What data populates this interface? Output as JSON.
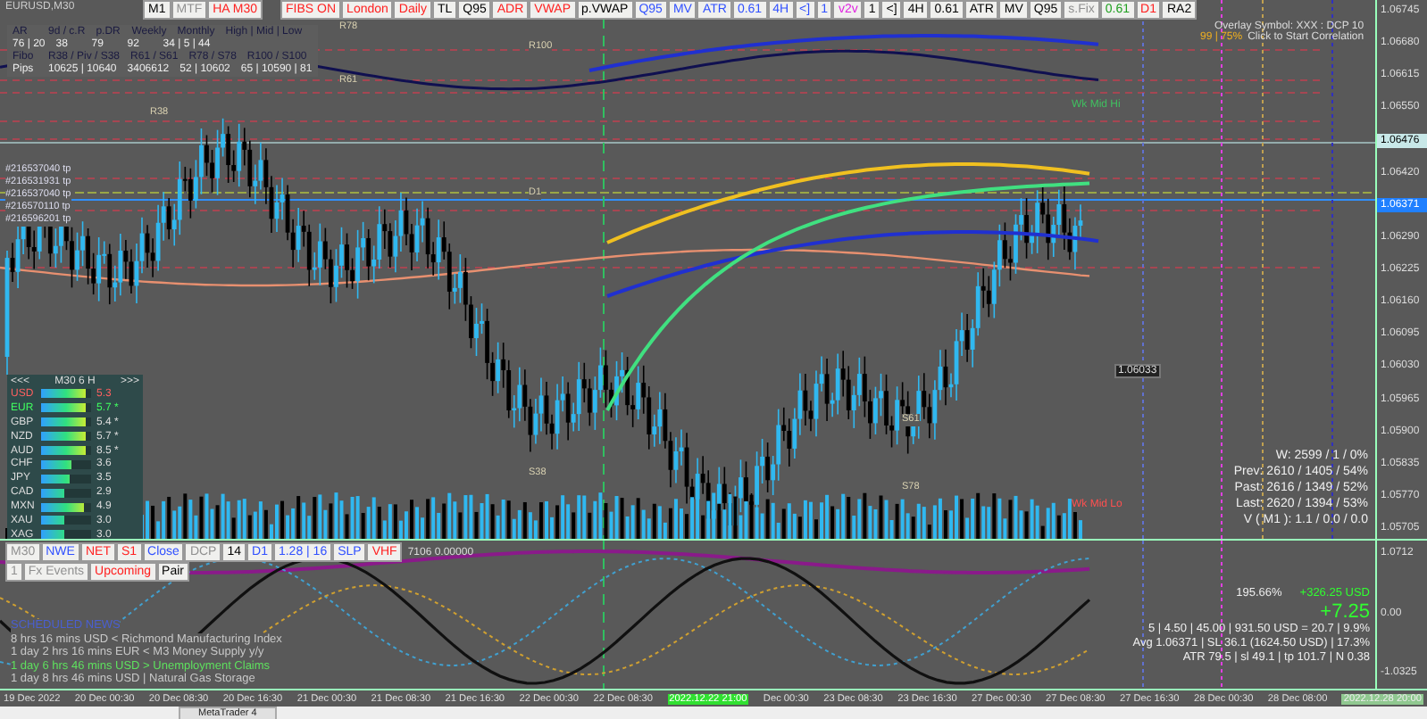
{
  "symbol": "EURUSD,M30",
  "toolbar_left": [
    {
      "label": "M1",
      "color": "#000000"
    },
    {
      "label": "MTF",
      "color": "#909090"
    },
    {
      "label": "HA M30",
      "color": "#ff2020"
    }
  ],
  "toolbar_right": [
    {
      "label": "FIBS ON",
      "color": "#ff2020"
    },
    {
      "label": "London",
      "color": "#ff2020"
    },
    {
      "label": "Daily",
      "color": "#ff2020"
    },
    {
      "label": "TL",
      "color": "#000000"
    },
    {
      "label": "Q95",
      "color": "#000000"
    },
    {
      "label": "ADR",
      "color": "#ff2020"
    },
    {
      "label": "VWAP",
      "color": "#ff2020"
    },
    {
      "label": "p.VWAP",
      "color": "#000000"
    },
    {
      "label": "Q95",
      "color": "#3050ff"
    },
    {
      "label": "MV",
      "color": "#3050ff"
    },
    {
      "label": "ATR",
      "color": "#3050ff"
    },
    {
      "label": "0.61",
      "color": "#3050ff"
    },
    {
      "label": "4H",
      "color": "#3050ff"
    },
    {
      "label": "<]",
      "color": "#3050ff"
    },
    {
      "label": "1",
      "color": "#3050ff"
    },
    {
      "label": "v2v",
      "color": "#e020e0"
    },
    {
      "label": "1",
      "color": "#000000"
    },
    {
      "label": "<]",
      "color": "#000000"
    },
    {
      "label": "4H",
      "color": "#000000"
    },
    {
      "label": "0.61",
      "color": "#000000"
    },
    {
      "label": "ATR",
      "color": "#000000"
    },
    {
      "label": "MV",
      "color": "#000000"
    },
    {
      "label": "Q95",
      "color": "#000000"
    },
    {
      "label": "s.Fix",
      "color": "#909090"
    },
    {
      "label": "0.61",
      "color": "#20a020"
    },
    {
      "label": "D1",
      "color": "#ff2020"
    },
    {
      "label": "RA2",
      "color": "#000000"
    }
  ],
  "range_table": {
    "header": [
      "AR",
      "9d / c.R",
      "p.DR",
      "Weekly",
      "Monthly",
      "High | Mid | Low"
    ],
    "values": [
      "76 | 20",
      "38",
      "79",
      "92",
      "34 | 5 | 44"
    ]
  },
  "fibo_table": {
    "header": [
      "Fibo",
      "R38 / Piv / S38",
      "R61 / S61",
      "R78 / S78",
      "R100 / S100"
    ],
    "values": [
      "Pips",
      "10625 | 10640",
      "3406612",
      "52 | 10602",
      "65 | 10590 | 81"
    ]
  },
  "orders": [
    "#216537040 tp",
    "#216531931 tp",
    "#216537040 tp",
    "#216570110 tp",
    "#216596201 tp"
  ],
  "levels": [
    "R78",
    "R61",
    "R38",
    "R100",
    "D1",
    "S38",
    "S61",
    "S78"
  ],
  "overlay": {
    "symbol_text": "Overlay Symbol: XXX : DCP 10",
    "count": "99 | 75%",
    "action": "Click to Start Correlation"
  },
  "weekly_mid": {
    "high": "Wk Mid Hi",
    "low": "Wk Mid Lo"
  },
  "volume_stats": [
    "W: 2599 / 1 / 0%",
    "Prev: 2610 / 1405 / 54%",
    "Past: 2616 / 1349 / 52%",
    "Last: 2620 / 1394 / 53%",
    "V ( M1 ): 1.1 / 0.0 / 0.0"
  ],
  "price_tag": "1.06033",
  "strength": {
    "prev": "<<<",
    "period": "M30 6 H",
    "next": ">>>",
    "rows": [
      {
        "name": "USD",
        "color": "#ff6060",
        "level": 0.9,
        "value": "5.3"
      },
      {
        "name": "EUR",
        "color": "#40ff60",
        "level": 0.9,
        "value": "5.7 *"
      },
      {
        "name": "GBP",
        "color": "#dddddd",
        "level": 0.9,
        "value": "5.4 *"
      },
      {
        "name": "NZD",
        "color": "#dddddd",
        "level": 0.88,
        "value": "5.7 *"
      },
      {
        "name": "AUD",
        "color": "#dddddd",
        "level": 0.88,
        "value": "8.5 *"
      },
      {
        "name": "CHF",
        "color": "#dddddd",
        "level": 0.6,
        "value": "3.6"
      },
      {
        "name": "JPY",
        "color": "#dddddd",
        "level": 0.58,
        "value": "3.5"
      },
      {
        "name": "CAD",
        "color": "#dddddd",
        "level": 0.45,
        "value": "2.9"
      },
      {
        "name": "MXN",
        "color": "#dddddd",
        "level": 0.85,
        "value": "4.9"
      },
      {
        "name": "XAU",
        "color": "#dddddd",
        "level": 0.45,
        "value": "3.0"
      },
      {
        "name": "XAG",
        "color": "#dddddd",
        "level": 0.45,
        "value": "3.0"
      }
    ]
  },
  "price_axis": [
    {
      "label": "1.06745",
      "kind": "tick"
    },
    {
      "label": "1.06680",
      "kind": "tick"
    },
    {
      "label": "1.06615",
      "kind": "tick"
    },
    {
      "label": "1.06550",
      "kind": "tick"
    },
    {
      "label": "1.06476",
      "kind": "bid"
    },
    {
      "label": "1.06420",
      "kind": "tick"
    },
    {
      "label": "1.06371",
      "kind": "avg"
    },
    {
      "label": "1.06290",
      "kind": "tick"
    },
    {
      "label": "1.06225",
      "kind": "tick"
    },
    {
      "label": "1.06160",
      "kind": "tick"
    },
    {
      "label": "1.06095",
      "kind": "tick"
    },
    {
      "label": "1.06030",
      "kind": "tick"
    },
    {
      "label": "1.05965",
      "kind": "tick"
    },
    {
      "label": "1.05900",
      "kind": "tick"
    },
    {
      "label": "1.05835",
      "kind": "tick"
    },
    {
      "label": "1.05770",
      "kind": "tick"
    },
    {
      "label": "1.05705",
      "kind": "tick"
    }
  ],
  "indicator_buttons_row1": [
    {
      "label": "M30",
      "color": "#909090"
    },
    {
      "label": "NWE",
      "color": "#3050ff"
    },
    {
      "label": "NET",
      "color": "#ff2020"
    },
    {
      "label": "S1",
      "color": "#ff2020"
    },
    {
      "label": "Close",
      "color": "#3050ff"
    },
    {
      "label": "DCP",
      "color": "#909090"
    },
    {
      "label": "14",
      "color": "#000000"
    },
    {
      "label": "D1",
      "color": "#3050ff"
    },
    {
      "label": "1.28 | 16",
      "color": "#3050ff"
    },
    {
      "label": "SLP",
      "color": "#3050ff"
    },
    {
      "label": "VHF",
      "color": "#ff2020"
    }
  ],
  "indicator_buttons_row2": [
    {
      "label": "1",
      "color": "#909090"
    },
    {
      "label": "Fx Events",
      "color": "#909090"
    },
    {
      "label": "Upcoming",
      "color": "#ff2020"
    },
    {
      "label": "Pair",
      "color": "#000000"
    }
  ],
  "indicator_value": "7106 0.00000",
  "news": {
    "title": "SCHEDULED NEWS",
    "items": [
      {
        "text": "8 hrs 16 mins  USD  <  Richmond Manufacturing Index",
        "color": "#c8c8c8"
      },
      {
        "text": "1 day 2 hrs 16 mins  EUR  <  M3 Money Supply y/y",
        "color": "#c8c8c8"
      },
      {
        "text": "1 day 6 hrs 46 mins  USD  >  Unemployment Claims",
        "color": "#5ee05e"
      },
      {
        "text": "1 day 8 hrs 46 mins  USD  |  Natural Gas Storage",
        "color": "#c8c8c8"
      }
    ]
  },
  "trade": {
    "percent": "195.66%",
    "profit": "+326.25 USD",
    "pips": "+7.25",
    "lines": [
      "5  |  4.50  |  45.00  |  931.50 USD = 20.7  |  9.9%",
      "Avg 1.06371  |  SL 36.1 (1624.50 USD)  |  17.3%",
      "ATR 79.5  |  sl 49.1  |  tp 101.7  |  N 0.38"
    ]
  },
  "indicator_axis": [
    "1.0712",
    "0.00",
    "-1.0325"
  ],
  "time_axis": [
    {
      "label": "19 Dec 2022",
      "kind": "tick"
    },
    {
      "label": "20 Dec 00:30",
      "kind": "tick"
    },
    {
      "label": "20 Dec 08:30",
      "kind": "tick"
    },
    {
      "label": "20 Dec 16:30",
      "kind": "tick"
    },
    {
      "label": "21 Dec 00:30",
      "kind": "tick"
    },
    {
      "label": "21 Dec 08:30",
      "kind": "tick"
    },
    {
      "label": "21 Dec 16:30",
      "kind": "tick"
    },
    {
      "label": "22 Dec 00:30",
      "kind": "tick"
    },
    {
      "label": "22 Dec 08:30",
      "kind": "tick"
    },
    {
      "label": "2022.12.22 21:00",
      "kind": "cursor"
    },
    {
      "label": "Dec 00:30",
      "kind": "tick"
    },
    {
      "label": "23 Dec 08:30",
      "kind": "tick"
    },
    {
      "label": "23 Dec 16:30",
      "kind": "tick"
    },
    {
      "label": "27 Dec 00:30",
      "kind": "tick"
    },
    {
      "label": "27 Dec 08:30",
      "kind": "tick"
    },
    {
      "label": "27 Dec 16:30",
      "kind": "tick"
    },
    {
      "label": "28 Dec 00:30",
      "kind": "tick"
    },
    {
      "label": "28 Dec 08:00",
      "kind": "tick"
    },
    {
      "label": "2022.12.28 20:00",
      "kind": "faded"
    }
  ],
  "taskbar_tab": "MetaTrader 4"
}
